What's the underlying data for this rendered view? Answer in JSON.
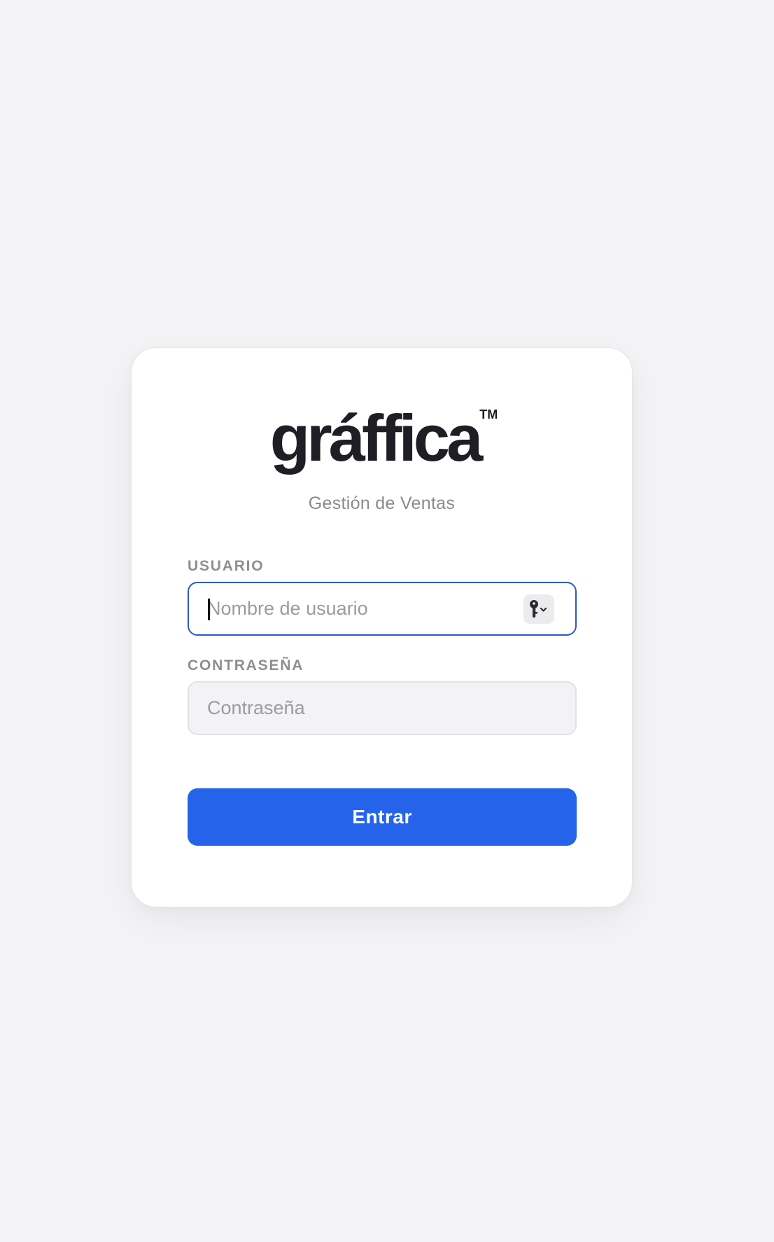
{
  "brand": {
    "logo_text": "gráffica",
    "trademark": "TM",
    "subtitle": "Gestión de Ventas"
  },
  "form": {
    "username": {
      "label": "USUARIO",
      "placeholder": "Nombre de usuario",
      "value": ""
    },
    "password": {
      "label": "CONTRASEÑA",
      "placeholder": "Contraseña",
      "value": ""
    },
    "submit_label": "Entrar",
    "password_manager_icon": "key-icon"
  },
  "colors": {
    "background": "#f4f4f6",
    "primary_button": "#2563eb",
    "focused_border": "#2d57c9",
    "logo": "#1e1e24",
    "label": "#8e8e93"
  }
}
